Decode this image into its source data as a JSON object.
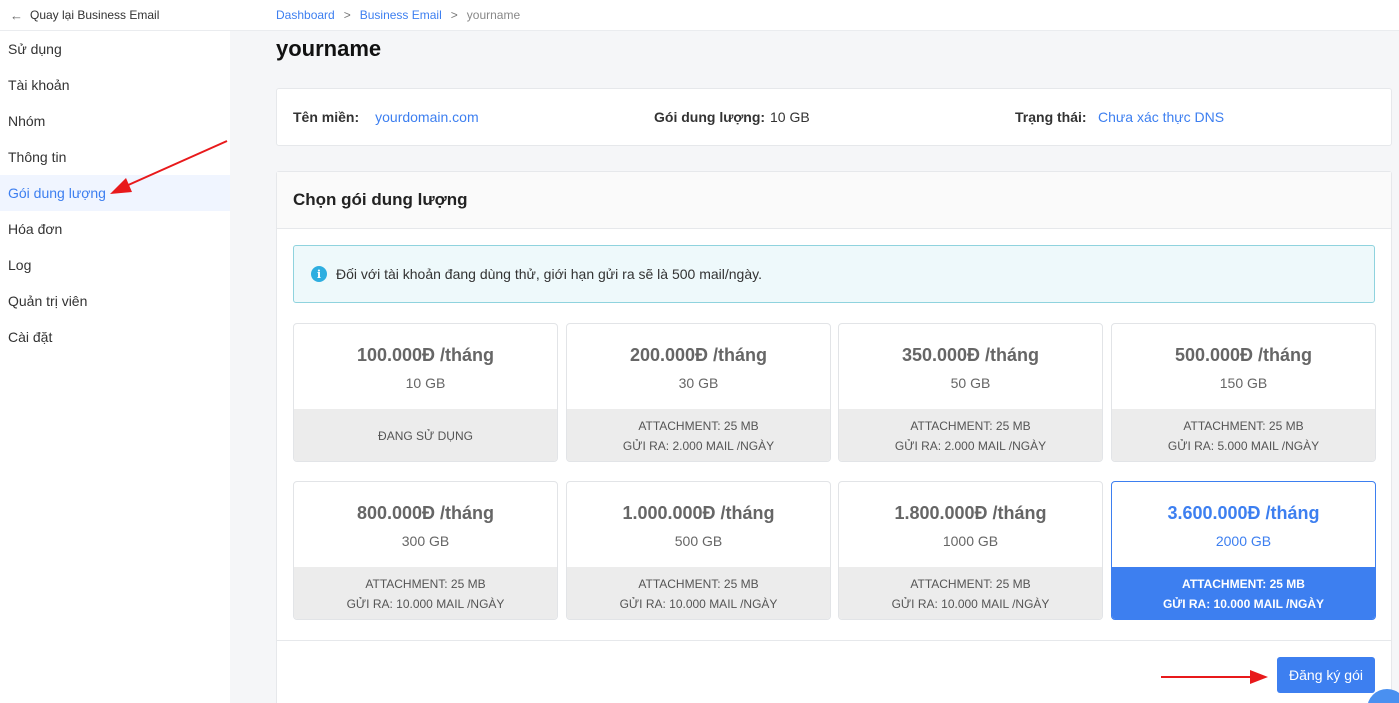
{
  "sidebar": {
    "back_label": "Quay lại Business Email",
    "items": [
      {
        "label": "Sử dụng"
      },
      {
        "label": "Tài khoản"
      },
      {
        "label": "Nhóm"
      },
      {
        "label": "Thông tin"
      },
      {
        "label": "Gói dung lượng",
        "active": true
      },
      {
        "label": "Hóa đơn"
      },
      {
        "label": "Log"
      },
      {
        "label": "Quản trị viên"
      },
      {
        "label": "Cài đặt"
      }
    ]
  },
  "breadcrumb": {
    "items": [
      "Dashboard",
      "Business Email",
      "yourname"
    ],
    "separator": ">"
  },
  "page_title": "yourname",
  "info": {
    "domain_label": "Tên miền:",
    "domain_value": "yourdomain.com",
    "package_label": "Gói dung lượng:",
    "package_value": "10 GB",
    "status_label": "Trạng thái:",
    "status_value": "Chưa xác thực DNS"
  },
  "package_section": {
    "title": "Chọn gói dung lượng",
    "notice": "Đối với tài khoản đang dùng thử, giới hạn gửi ra sẽ là 500 mail/ngày.",
    "plans": [
      {
        "price": "100.000Đ /tháng",
        "size": "10 GB",
        "line1": "ĐANG SỬ DỤNG",
        "line2": ""
      },
      {
        "price": "200.000Đ /tháng",
        "size": "30 GB",
        "line1": "ATTACHMENT: 25 MB",
        "line2": "GỬI RA: 2.000 MAIL /NGÀY"
      },
      {
        "price": "350.000Đ /tháng",
        "size": "50 GB",
        "line1": "ATTACHMENT: 25 MB",
        "line2": "GỬI RA: 2.000 MAIL /NGÀY"
      },
      {
        "price": "500.000Đ /tháng",
        "size": "150 GB",
        "line1": "ATTACHMENT: 25 MB",
        "line2": "GỬI RA: 5.000 MAIL /NGÀY"
      },
      {
        "price": "800.000Đ /tháng",
        "size": "300 GB",
        "line1": "ATTACHMENT: 25 MB",
        "line2": "GỬI RA: 10.000 MAIL /NGÀY"
      },
      {
        "price": "1.000.000Đ /tháng",
        "size": "500 GB",
        "line1": "ATTACHMENT: 25 MB",
        "line2": "GỬI RA: 10.000 MAIL /NGÀY"
      },
      {
        "price": "1.800.000Đ /tháng",
        "size": "1000 GB",
        "line1": "ATTACHMENT: 25 MB",
        "line2": "GỬI RA: 10.000 MAIL /NGÀY"
      },
      {
        "price": "3.600.000Đ /tháng",
        "size": "2000 GB",
        "line1": "ATTACHMENT: 25 MB",
        "line2": "GỬI RA: 10.000 MAIL /NGÀY",
        "selected": true
      }
    ],
    "register_label": "Đăng ký gói"
  },
  "colors": {
    "accent": "#3d7ff0",
    "annotation_arrow": "#e8191b"
  }
}
